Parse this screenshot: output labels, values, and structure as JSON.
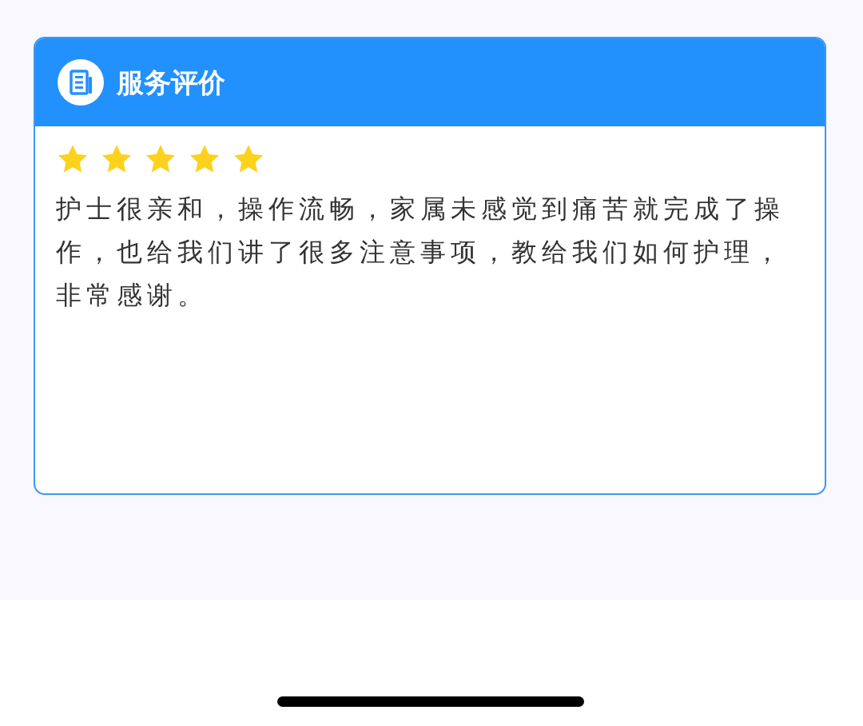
{
  "header": {
    "title": "服务评价"
  },
  "review": {
    "stars": 5,
    "text": "护士很亲和，操作流畅，家属未感觉到痛苦就完成了操作，也给我们讲了很多注意事项，教给我们如何护理，非常感谢。"
  }
}
